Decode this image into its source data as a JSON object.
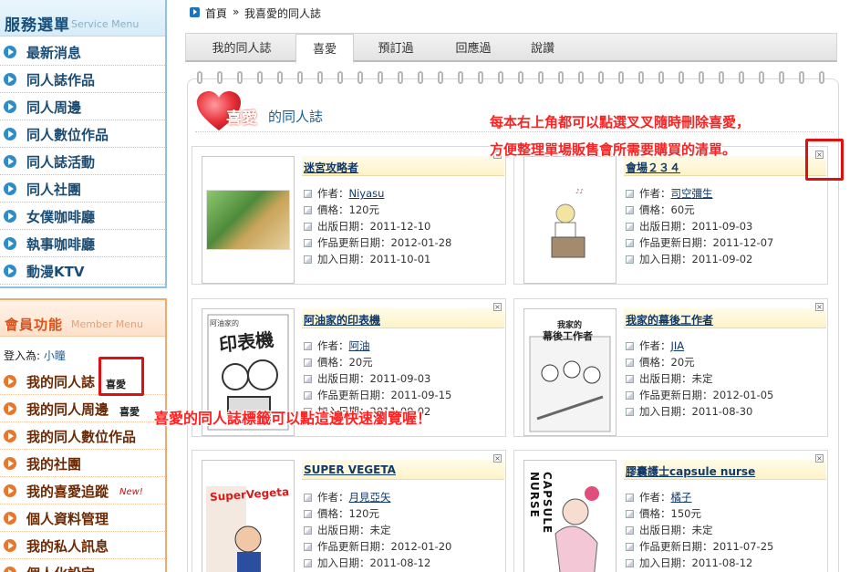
{
  "service_menu": {
    "title": "服務選單",
    "subtitle": "Service Menu",
    "items": [
      "最新消息",
      "同人誌作品",
      "同人周邊",
      "同人數位作品",
      "同人誌活動",
      "同人社團",
      "女僕咖啡廳",
      "執事咖啡廳",
      "動漫KTV"
    ]
  },
  "member_menu": {
    "title": "會員功能",
    "subtitle": "Member Menu",
    "login_label": "登入為:",
    "login_user": "小瞳",
    "items": [
      {
        "label": "我的同人誌",
        "tag": "喜愛"
      },
      {
        "label": "我的同人周邊",
        "tag": "喜愛"
      },
      {
        "label": "我的同人數位作品",
        "tag": ""
      },
      {
        "label": "我的社團",
        "tag": ""
      },
      {
        "label": "我的喜愛追蹤",
        "tag": "New!"
      },
      {
        "label": "個人資料管理",
        "tag": ""
      },
      {
        "label": "我的私人訊息",
        "tag": ""
      },
      {
        "label": "個人化設定",
        "tag": ""
      }
    ]
  },
  "breadcrumb": {
    "home": "首頁",
    "separator": "»",
    "current": "我喜愛的同人誌"
  },
  "tabs": [
    "我的同人誌",
    "喜愛",
    "預訂過",
    "回應過",
    "說讚"
  ],
  "active_tab": "喜愛",
  "section": {
    "heart_word": "喜愛",
    "rest": "的同人誌"
  },
  "field_labels": {
    "author": "作者：",
    "price": "價格：",
    "pub_date": "出版日期：",
    "updated": "作品更新日期：",
    "added": "加入日期："
  },
  "books": [
    {
      "title": "迷宮攻略者",
      "author": "Niyasu",
      "price": "120元",
      "pub_date": "2011-12-10",
      "updated": "2012-01-28",
      "added": "2011-10-01"
    },
    {
      "title": "會場２３４",
      "author": "司空彌生",
      "price": "60元",
      "pub_date": "2011-09-03",
      "updated": "2011-12-07",
      "added": "2011-09-02"
    },
    {
      "title": "阿油家的印表機",
      "author": "阿油",
      "price": "20元",
      "pub_date": "2011-09-03",
      "updated": "2011-09-15",
      "added": "2011-09-02"
    },
    {
      "title": "我家的幕後工作者",
      "author": "JIA",
      "price": "20元",
      "pub_date": "未定",
      "updated": "2012-01-05",
      "added": "2011-08-30"
    },
    {
      "title": "SUPER VEGETA",
      "author": "月見亞矢",
      "price": "120元",
      "pub_date": "未定",
      "updated": "2012-01-20",
      "added": "2011-08-12"
    },
    {
      "title": "膠囊護士capsule nurse",
      "author": "橘子",
      "price": "150元",
      "pub_date": "未定",
      "updated": "2011-07-25",
      "added": "2011-08-12"
    }
  ],
  "cover_text": {
    "printer_small": "阿油家的",
    "printer_big": "印表機",
    "backstage_line1": "我家的",
    "backstage_line2": "幕後工作者",
    "vegeta": "SuperVegeta",
    "capsule": "CAPSULE NURSE"
  },
  "annotations": {
    "top_line1": "每本右上角都可以點選叉叉隨時刪除喜愛，",
    "top_line2": "方便整理單場販售會所需要購買的清單。",
    "left": "喜愛的同人誌標籤可以點這邊快速瀏覽喔！"
  },
  "colors": {
    "service_accent": "#2f8cc7",
    "member_accent": "#e8772e",
    "annotation": "#ff2020",
    "heart": "#e8323a"
  }
}
